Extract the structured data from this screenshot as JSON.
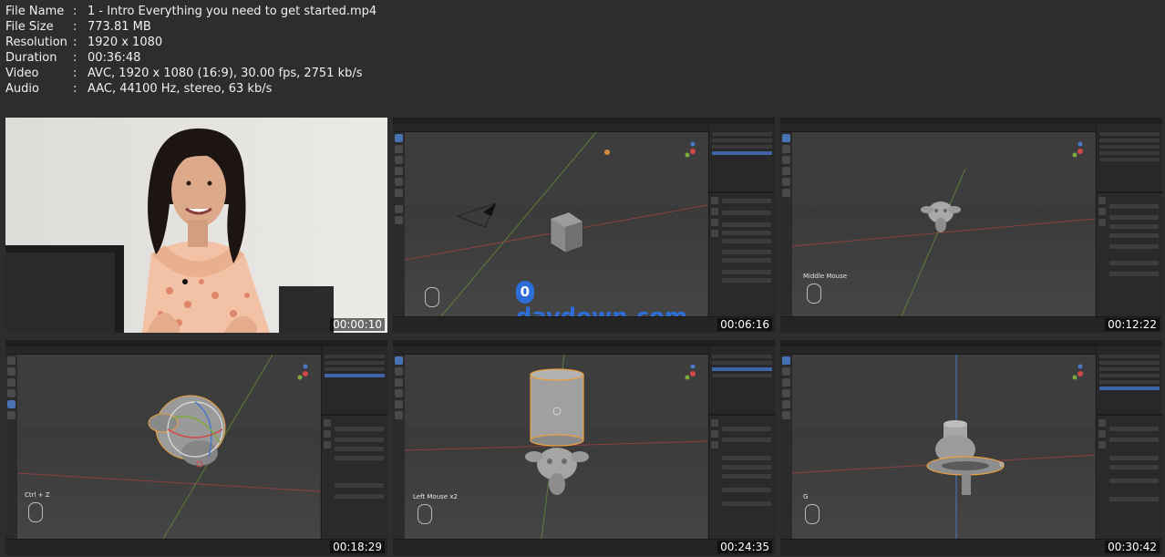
{
  "info": [
    {
      "label": "File Name",
      "sep": ":",
      "value": "1 - Intro Everything you need to get started.mp4"
    },
    {
      "label": "File Size",
      "sep": ":",
      "value": "773.81 MB"
    },
    {
      "label": "Resolution",
      "sep": ":",
      "value": "1920 x 1080"
    },
    {
      "label": "Duration",
      "sep": ":",
      "value": "00:36:48"
    },
    {
      "label": "Video",
      "sep": ":",
      "value": "AVC, 1920 x 1080 (16:9), 30.00 fps, 2751 kb/s"
    },
    {
      "label": "Audio",
      "sep": ":",
      "value": "AAC, 44100 Hz, stereo, 63 kb/s"
    }
  ],
  "thumbnails": [
    {
      "timestamp": "00:00:10"
    },
    {
      "timestamp": "00:06:16",
      "watermark": "daydown.com",
      "watermark_badge": "0"
    },
    {
      "timestamp": "00:12:22",
      "hint": "Middle Mouse"
    },
    {
      "timestamp": "00:18:29",
      "hint": "Ctrl + Z"
    },
    {
      "timestamp": "00:24:35",
      "hint": "Left Mouse x2"
    },
    {
      "timestamp": "00:30:42",
      "hint": "G"
    }
  ],
  "colors": {
    "background": "#2d2d2d",
    "info_text": "#f0f0f0",
    "watermark": "#2c6ed5",
    "selection_orange": "#e8a040"
  }
}
